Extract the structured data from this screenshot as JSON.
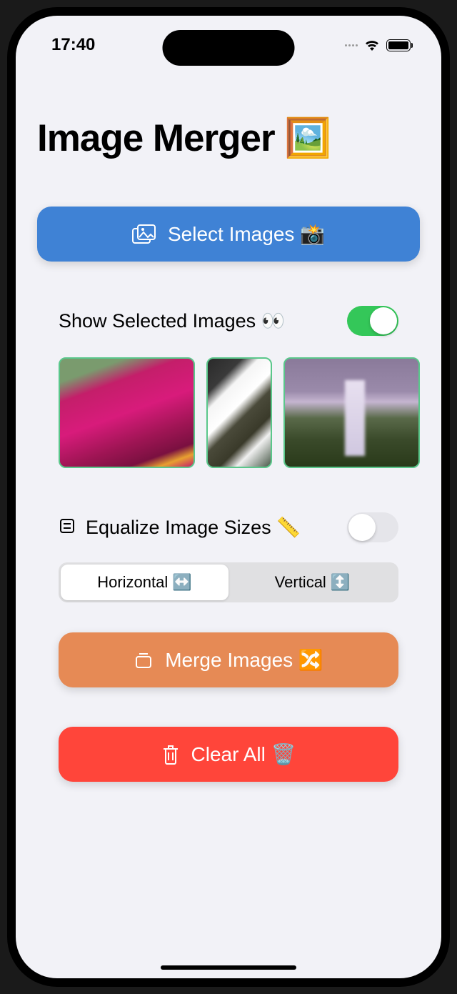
{
  "status": {
    "time": "17:40"
  },
  "title": "Image Merger 🖼️",
  "select_btn": "Select Images 📸",
  "show_selected": {
    "label": "Show Selected Images 👀",
    "on": true
  },
  "thumbnails": [
    {
      "name": "image-1"
    },
    {
      "name": "image-2"
    },
    {
      "name": "image-3"
    }
  ],
  "equalize": {
    "label": "Equalize Image Sizes 📏",
    "on": false
  },
  "direction": {
    "options": [
      "Horizontal ↔️",
      "Vertical ↕️"
    ],
    "selected": 0
  },
  "merge_btn": "Merge Images 🔀",
  "clear_btn": "Clear All 🗑️"
}
